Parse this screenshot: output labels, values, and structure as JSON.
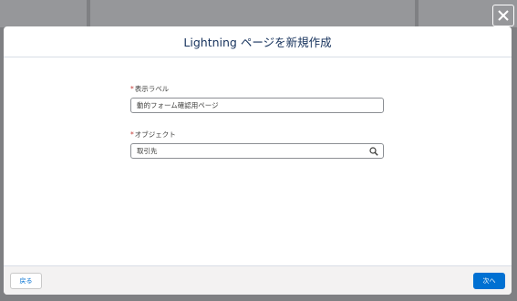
{
  "modal": {
    "title": "Lightning ページを新規作成",
    "fields": [
      {
        "required_mark": "*",
        "label": "表示ラベル",
        "value": "動的フォーム確認用ページ"
      },
      {
        "required_mark": "*",
        "label": "オブジェクト",
        "value": "取引先",
        "icon": "search-icon"
      }
    ],
    "footer": {
      "back_label": "戻る",
      "next_label": "次へ"
    },
    "close_icon": "close-icon"
  },
  "colors": {
    "overlay": "#7f8083",
    "brand": "#0070d2",
    "required": "#c23934",
    "title": "#16325c"
  }
}
